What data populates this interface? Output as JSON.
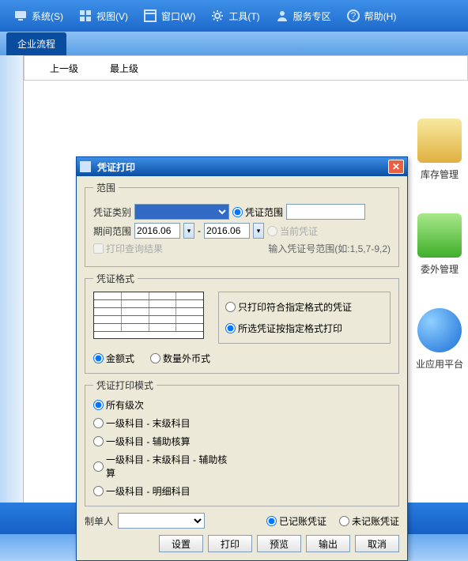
{
  "menu": {
    "system": "系统(S)",
    "view": "视图(V)",
    "window": "窗口(W)",
    "tools": "工具(T)",
    "service": "服务专区",
    "help": "帮助(H)"
  },
  "tab": {
    "workflow": "企业流程"
  },
  "crumb": {
    "up": "上一级",
    "top": "最上级"
  },
  "desktop": {
    "inventory": "库存管理",
    "outsource": "委外管理",
    "platform": "业应用平台"
  },
  "dialog": {
    "title": "凭证打印",
    "group_scope": "范围",
    "lbl_type": "凭证类别",
    "type_value": "",
    "opt_range": "凭证范围",
    "range_value": "",
    "lbl_period": "期间范围",
    "period_from": "2016.06",
    "period_to": "2016.06",
    "opt_current": "当前凭证",
    "chk_query": "打印查询结果",
    "hint_range": "输入凭证号范围(如:1,5,7-9,2)",
    "group_format": "凭证格式",
    "opt_only": "只打印符合指定格式的凭证",
    "opt_by": "所选凭证按指定格式打印",
    "fmt_amount": "金额式",
    "fmt_qtyfc": "数量外币式",
    "group_mode": "凭证打印模式",
    "mode_all": "所有级次",
    "mode_l1_last": "一级科目 - 末级科目",
    "mode_l1_aux": "一级科目 - 辅助核算",
    "mode_l1_last_aux": "一级科目 - 末级科目 - 辅助核算",
    "mode_l1_detail": "一级科目 - 明细科目",
    "lbl_maker": "制单人",
    "maker_value": "",
    "opt_posted": "已记账凭证",
    "opt_unposted": "未记账凭证",
    "btn_settings": "设置",
    "btn_print": "打印",
    "btn_preview": "预览",
    "btn_export": "输出",
    "btn_cancel": "取消"
  }
}
